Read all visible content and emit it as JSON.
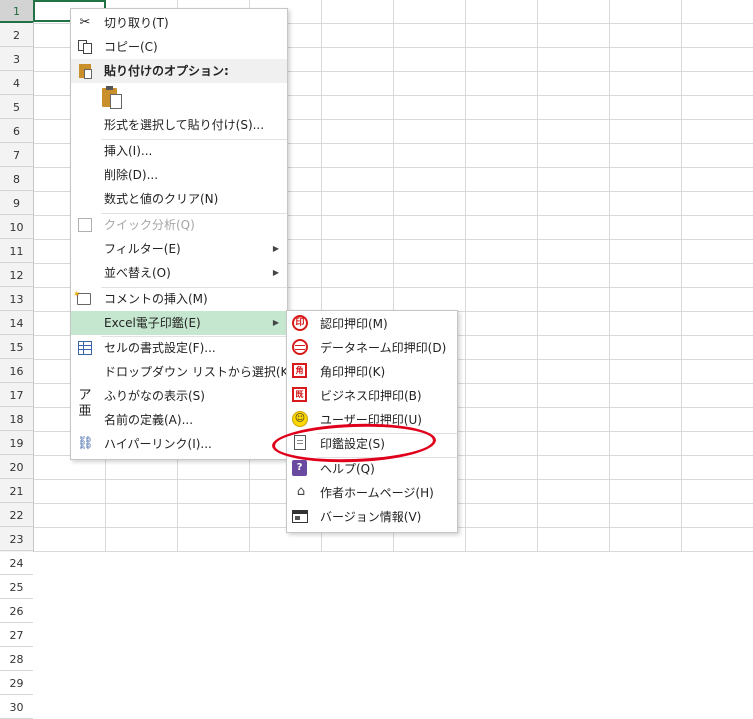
{
  "sheet": {
    "rows": [
      "1",
      "2",
      "3",
      "4",
      "5",
      "6",
      "7",
      "8",
      "9",
      "10",
      "11",
      "12",
      "13",
      "14",
      "15",
      "16",
      "17",
      "18",
      "19",
      "20",
      "21",
      "22",
      "23",
      "24",
      "25",
      "26",
      "27",
      "28",
      "29",
      "30"
    ],
    "active_row": "1"
  },
  "context_menu": {
    "cut": "切り取り(T)",
    "copy": "コピー(C)",
    "paste_options_header": "貼り付けのオプション:",
    "paste_special": "形式を選択して貼り付け(S)...",
    "insert": "挿入(I)...",
    "delete": "削除(D)...",
    "clear_contents": "数式と値のクリア(N)",
    "quick_analysis": "クイック分析(Q)",
    "filter": "フィルター(E)",
    "sort": "並べ替え(O)",
    "insert_comment": "コメントの挿入(M)",
    "excel_seal": "Excel電子印鑑(E)",
    "format_cells": "セルの書式設定(F)...",
    "pick_from_dropdown": "ドロップダウン リストから選択(K)...",
    "show_phonetic": "ふりがなの表示(S)",
    "define_name": "名前の定義(A)...",
    "hyperlink": "ハイパーリンク(I)...",
    "furi_glyph_top": "ア",
    "furi_glyph_bottom": "亜"
  },
  "submenu": {
    "seal_approval": "認印押印(M)",
    "seal_dataname": "データネーム印押印(D)",
    "seal_square": "角印押印(K)",
    "seal_business": "ビジネス印押印(B)",
    "seal_user": "ユーザー印押印(U)",
    "seal_settings": "印鑑設定(S)",
    "help": "ヘルプ(Q)",
    "author_homepage": "作者ホームページ(H)",
    "version_info": "バージョン情報(V)",
    "seal_char": "印",
    "square_char": "角",
    "business_char": "既"
  },
  "colors": {
    "accent_green": "#217346",
    "menu_highlight": "#c6e7cf",
    "annotation_red": "#e0001b",
    "seal_red": "#d61a1a"
  }
}
